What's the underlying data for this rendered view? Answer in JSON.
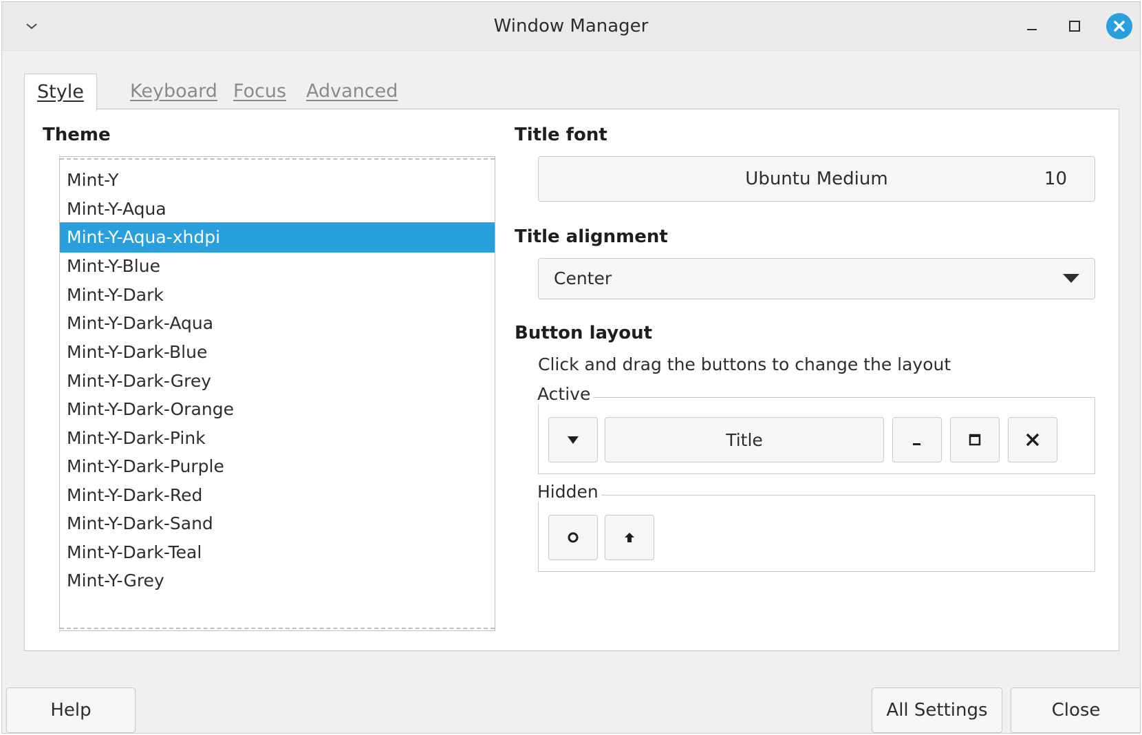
{
  "window": {
    "title": "Window Manager"
  },
  "tabs": [
    {
      "label": "Style",
      "active": true
    },
    {
      "label": "Keyboard",
      "active": false
    },
    {
      "label": "Focus",
      "active": false
    },
    {
      "label": "Advanced",
      "active": false
    }
  ],
  "theme": {
    "heading": "Theme",
    "items": [
      "Mint-Y",
      "Mint-Y-Aqua",
      "Mint-Y-Aqua-xhdpi",
      "Mint-Y-Blue",
      "Mint-Y-Dark",
      "Mint-Y-Dark-Aqua",
      "Mint-Y-Dark-Blue",
      "Mint-Y-Dark-Grey",
      "Mint-Y-Dark-Orange",
      "Mint-Y-Dark-Pink",
      "Mint-Y-Dark-Purple",
      "Mint-Y-Dark-Red",
      "Mint-Y-Dark-Sand",
      "Mint-Y-Dark-Teal",
      "Mint-Y-Grey"
    ],
    "selected": "Mint-Y-Aqua-xhdpi"
  },
  "title_font": {
    "heading": "Title font",
    "name": "Ubuntu Medium",
    "size": "10"
  },
  "title_alignment": {
    "heading": "Title alignment",
    "value": "Center"
  },
  "button_layout": {
    "heading": "Button layout",
    "hint": "Click and drag the buttons to change the layout",
    "active_label": "Active",
    "hidden_label": "Hidden",
    "title_button": "Title",
    "active_buttons": [
      "menu-arrow-icon",
      "title",
      "minimize-icon",
      "maximize-icon",
      "close-icon"
    ],
    "hidden_buttons": [
      "stick-icon",
      "shade-icon"
    ]
  },
  "footer": {
    "help": "Help",
    "all_settings": "All Settings",
    "close": "Close"
  },
  "colors": {
    "accent": "#2a9fdd",
    "background": "#f0f0f0",
    "panel": "#ffffff"
  }
}
